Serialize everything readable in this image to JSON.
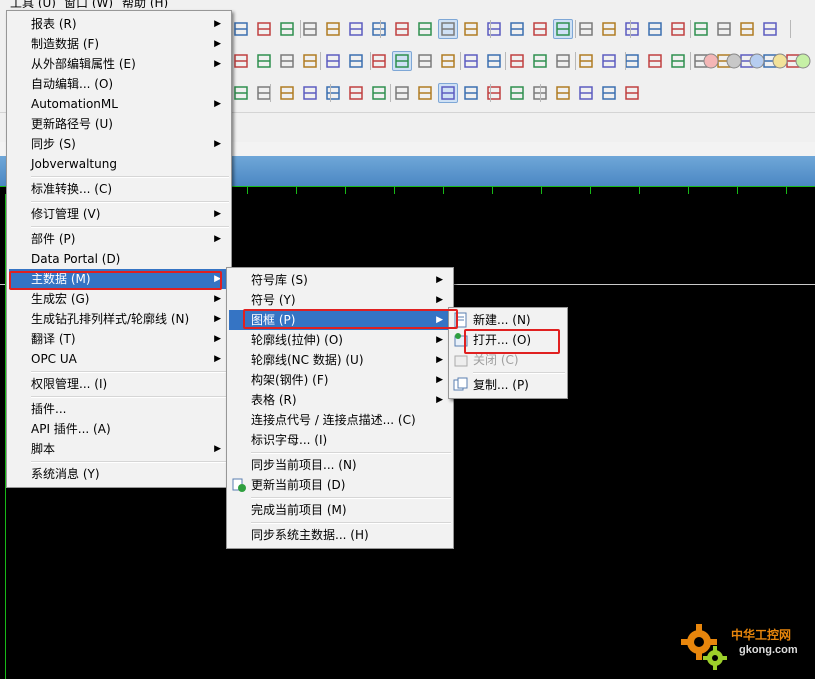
{
  "menubar": {
    "items": [
      "工具 (U)",
      "窗口 (W)",
      "帮助 (H)"
    ]
  },
  "tools_menu": {
    "items": [
      {
        "label": "报表 (R)",
        "submenu": true
      },
      {
        "label": "制造数据 (F)",
        "submenu": true
      },
      {
        "label": "从外部编辑属性 (E)",
        "submenu": true
      },
      {
        "label": "自动编辑... (O)",
        "submenu": false
      },
      {
        "label": "AutomationML",
        "submenu": true
      },
      {
        "label": "更新路径号 (U)",
        "submenu": false
      },
      {
        "label": "同步 (S)",
        "submenu": true
      },
      {
        "label": "Jobverwaltung",
        "submenu": false
      },
      {
        "label": "标准转换... (C)",
        "submenu": false
      },
      {
        "label": "修订管理 (V)",
        "submenu": true
      },
      {
        "label": "部件 (P)",
        "submenu": true
      },
      {
        "label": "Data Portal (D)",
        "submenu": false
      },
      {
        "label": "主数据 (M)",
        "submenu": true
      },
      {
        "label": "生成宏 (G)",
        "submenu": true
      },
      {
        "label": "生成钻孔排列样式/轮廓线 (N)",
        "submenu": true
      },
      {
        "label": "翻译 (T)",
        "submenu": true
      },
      {
        "label": "OPC UA",
        "submenu": true
      },
      {
        "label": "权限管理... (I)",
        "submenu": false
      },
      {
        "label": "插件...",
        "submenu": false
      },
      {
        "label": "API 插件... (A)",
        "submenu": false
      },
      {
        "label": "脚本",
        "submenu": true
      },
      {
        "label": "系统消息 (Y)",
        "submenu": false
      }
    ]
  },
  "masterdata_menu": {
    "items": [
      {
        "label": "符号库 (S)",
        "submenu": true
      },
      {
        "label": "符号 (Y)",
        "submenu": true
      },
      {
        "label": "图框 (P)",
        "submenu": true
      },
      {
        "label": "轮廓线(拉伸) (O)",
        "submenu": true
      },
      {
        "label": "轮廓线(NC 数据) (U)",
        "submenu": true
      },
      {
        "label": "构架(钢件) (F)",
        "submenu": true
      },
      {
        "label": "表格 (R)",
        "submenu": true
      },
      {
        "label": "连接点代号 / 连接点描述... (C)",
        "submenu": false
      },
      {
        "label": "标识字母... (I)",
        "submenu": false
      },
      {
        "label": "同步当前项目... (N)",
        "submenu": false
      },
      {
        "label": "更新当前项目 (D)",
        "submenu": false
      },
      {
        "label": "完成当前项目 (M)",
        "submenu": false
      },
      {
        "label": "同步系统主数据... (H)",
        "submenu": false
      }
    ]
  },
  "frame_menu": {
    "items": [
      {
        "label": "新建... (N)"
      },
      {
        "label": "打开... (O)"
      },
      {
        "label": "关闭 (C)"
      },
      {
        "label": "复制... (P)"
      }
    ]
  },
  "watermark": {
    "cn": "中华工控网",
    "url": "gkong.com"
  },
  "colors": {
    "highlight": "#3574c4",
    "annotation": "#e02020",
    "canvas": "#000000",
    "grid": "#18b818"
  }
}
